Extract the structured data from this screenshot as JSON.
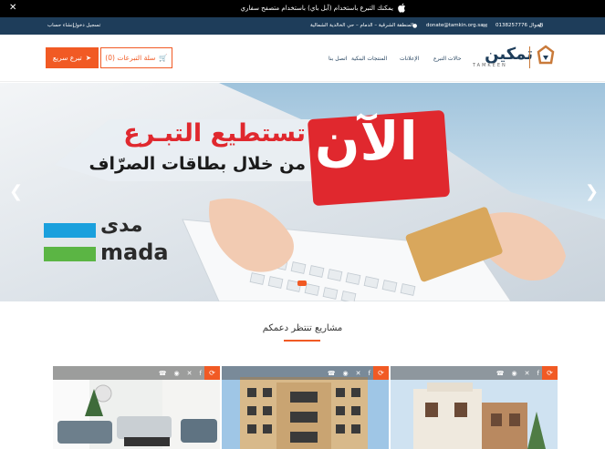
{
  "topbar": {
    "message": "يمكنك التبرع باستخدام (آبل باي) باستخدام متصفح سفاري",
    "close": "✕"
  },
  "infobar": {
    "phone": "الجوال 0138257776",
    "email": "donate@tamkin.org.sa",
    "address": "المنطقة الشرقية – الدمام – حي الخالدية الشمالية",
    "signup": "إنشاء حساب",
    "login": "تسجيل دخول"
  },
  "logo": {
    "ar": "تمكين",
    "en": "TAMKEEN"
  },
  "nav": [
    "حالات التبرع",
    "الإعلانات",
    "المنتجات البنكية",
    "اتصل بنا"
  ],
  "buttons": {
    "cart": "سلة التبرعات (0)",
    "quick": "تبرع سريع"
  },
  "banner": {
    "headline": "الآن",
    "line1": "تستطيع التبـرع",
    "line2": "من خلال بطاقات الصرّاف",
    "mada_ar": "مدى",
    "mada_en": "mada"
  },
  "section": {
    "title": "مشاريع تنتظر دعمكم"
  },
  "cards": [
    {
      "name": "project-card-1"
    },
    {
      "name": "project-card-2"
    },
    {
      "name": "project-card-3"
    }
  ],
  "colors": {
    "accent": "#f15a24",
    "navy": "#1e3d5a"
  }
}
